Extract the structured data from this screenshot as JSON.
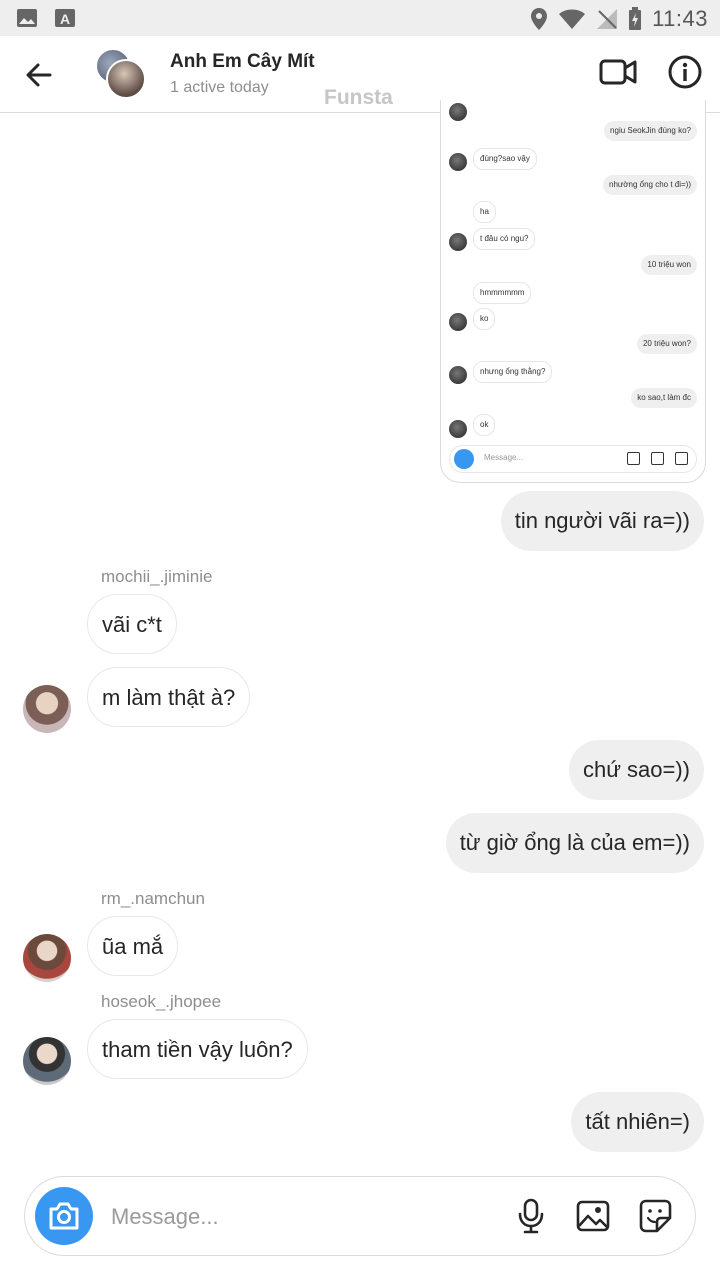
{
  "status_bar": {
    "time": "11:43",
    "icons": [
      "image-icon",
      "text-a-icon",
      "location-icon",
      "wifi-icon",
      "no-signal-icon",
      "battery-charging-icon"
    ]
  },
  "header": {
    "title": "Anh Em Cây Mít",
    "status": "1 active today",
    "watermark": "Funsta",
    "icons": [
      "back-arrow-icon",
      "group-avatar",
      "video-call-icon",
      "info-icon"
    ]
  },
  "shared_image": {
    "messages": [
      {
        "dir": "out",
        "text": "ngiu SeokJin đúng ko?"
      },
      {
        "dir": "in",
        "text": "đúng?sao vậy",
        "avatar": true
      },
      {
        "dir": "out",
        "text": "nhường ổng cho t đi=))"
      },
      {
        "dir": "in",
        "text": "ha"
      },
      {
        "dir": "in",
        "text": "t đâu có ngu?",
        "avatar": true
      },
      {
        "dir": "out",
        "text": "10 triệu won"
      },
      {
        "dir": "in",
        "text": "hmmmmmm"
      },
      {
        "dir": "in",
        "text": "ko",
        "avatar": true
      },
      {
        "dir": "out",
        "text": "20 triệu won?"
      },
      {
        "dir": "in",
        "text": "nhưng ổng thằng?",
        "avatar": true
      },
      {
        "dir": "out",
        "text": "ko sao,t làm đc"
      },
      {
        "dir": "in",
        "text": "ok",
        "avatar": true
      }
    ],
    "composer_placeholder": "Message..."
  },
  "messages": {
    "m1": "tin người vãi ra=))",
    "sender1": "mochii_.jiminie",
    "m2": "vãi c*t",
    "m3": "m làm thật à?",
    "m4": "chứ sao=))",
    "m5": "từ giờ ổng là của em=))",
    "sender2": "rm_.namchun",
    "m6": "ũa mắ",
    "sender3": "hoseok_.jhopee",
    "m7": "tham tiền vậy luôn?",
    "m8": "tất nhiên=)"
  },
  "composer": {
    "placeholder": "Message...",
    "icons": [
      "camera-icon",
      "microphone-icon",
      "gallery-icon",
      "sticker-icon"
    ]
  },
  "colors": {
    "accent": "#3897f0",
    "outgoing_bubble": "#efefef",
    "secondary_text": "#8e8e8e"
  }
}
